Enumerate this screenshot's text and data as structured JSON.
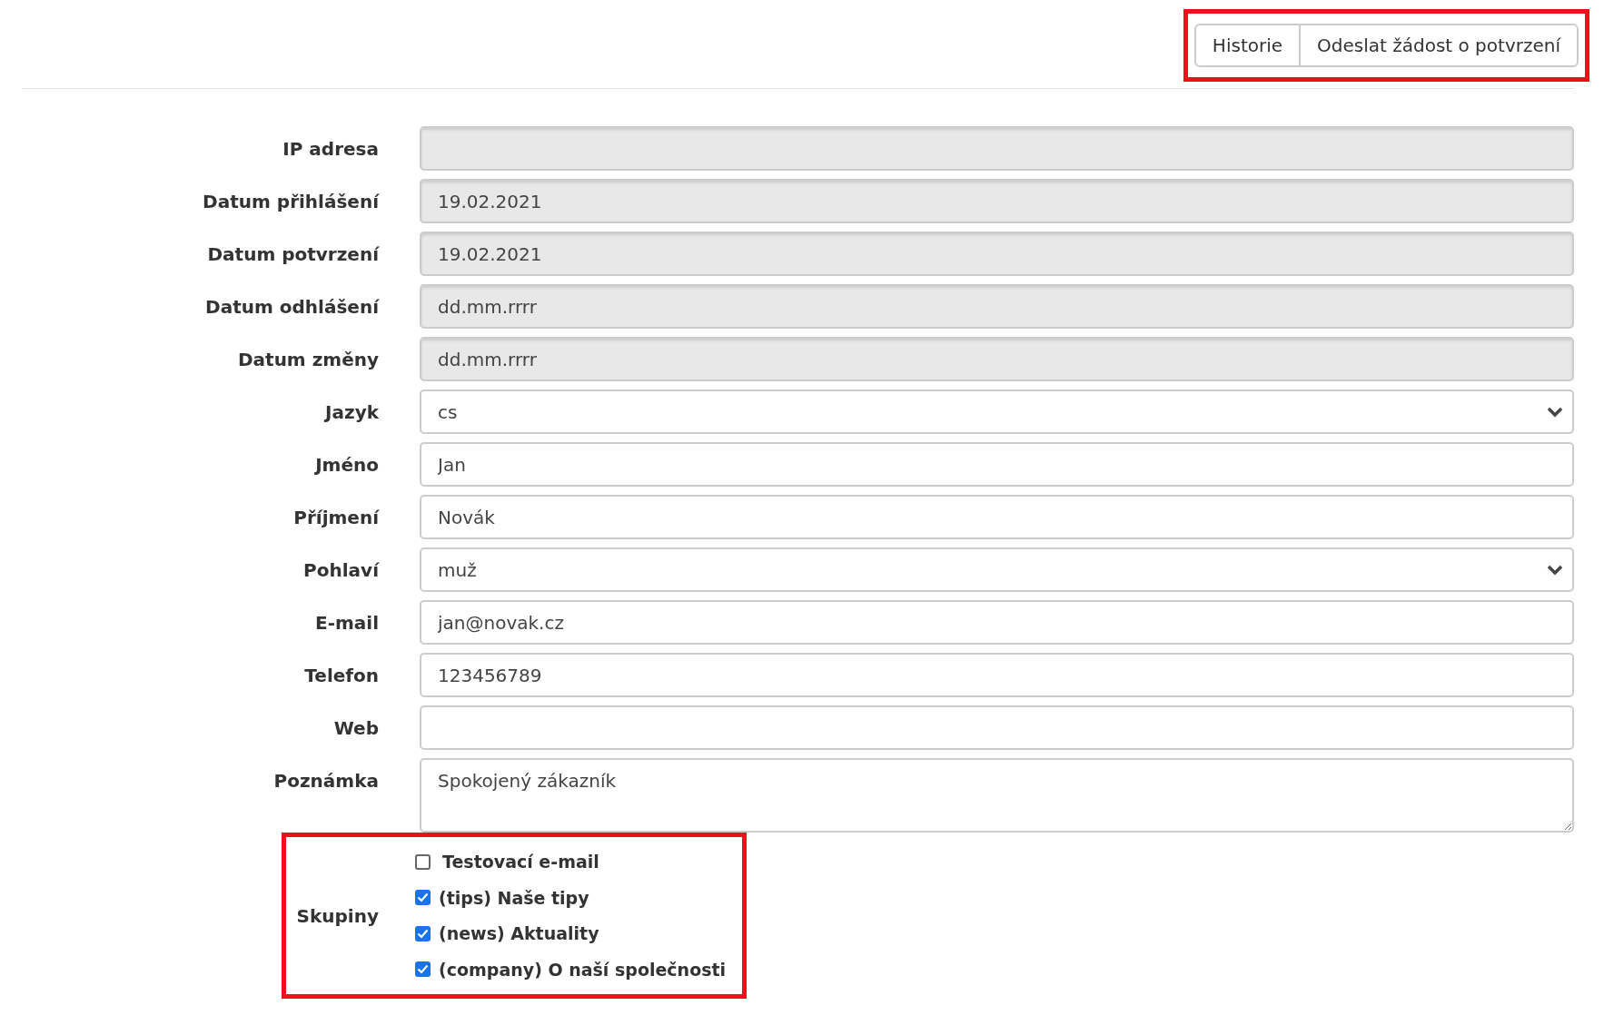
{
  "header_buttons": {
    "highlighted": true,
    "buttons": [
      "Historie",
      "Odeslat žádost o potvrzení"
    ]
  },
  "fields": [
    {
      "label": "IP adresa",
      "kind": "text",
      "disabled": true
    },
    {
      "label": "Datum přihlášení",
      "kind": "date",
      "disabled": true,
      "value": "19.02.2021"
    },
    {
      "label": "Datum potvrzení",
      "kind": "date",
      "disabled": true,
      "value": "19.02.2021"
    },
    {
      "label": "Datum odhlášení",
      "kind": "date",
      "disabled": true,
      "placeholder": "dd.mm.rrrr"
    },
    {
      "label": "Datum změny",
      "kind": "date",
      "disabled": true,
      "placeholder": "dd.mm.rrrr"
    },
    {
      "label": "Jazyk",
      "kind": "select",
      "disabled": false,
      "value": "cs"
    },
    {
      "label": "Jméno",
      "kind": "text",
      "disabled": false,
      "value": "Jan"
    },
    {
      "label": "Příjmení",
      "kind": "text",
      "disabled": false,
      "value": "Novák"
    },
    {
      "label": "Pohlaví",
      "kind": "select",
      "disabled": false,
      "value": "muž"
    },
    {
      "label": "E-mail",
      "kind": "text",
      "disabled": false,
      "value": "jan@novak.cz"
    },
    {
      "label": "Telefon",
      "kind": "text",
      "disabled": false,
      "value": "123456789"
    },
    {
      "label": "Web",
      "kind": "text",
      "disabled": false
    },
    {
      "label": "Poznámka",
      "kind": "textarea",
      "disabled": false,
      "value": "Spokojený zákazník"
    }
  ],
  "groups": {
    "label": "Skupiny",
    "highlighted": true,
    "items": [
      {
        "label": "Testovací e-mail",
        "checked": false
      },
      {
        "label": "(tips) Naše tipy",
        "checked": true
      },
      {
        "label": "(news) Aktuality",
        "checked": true
      },
      {
        "label": "(company) O naší společnosti",
        "checked": true
      }
    ]
  }
}
